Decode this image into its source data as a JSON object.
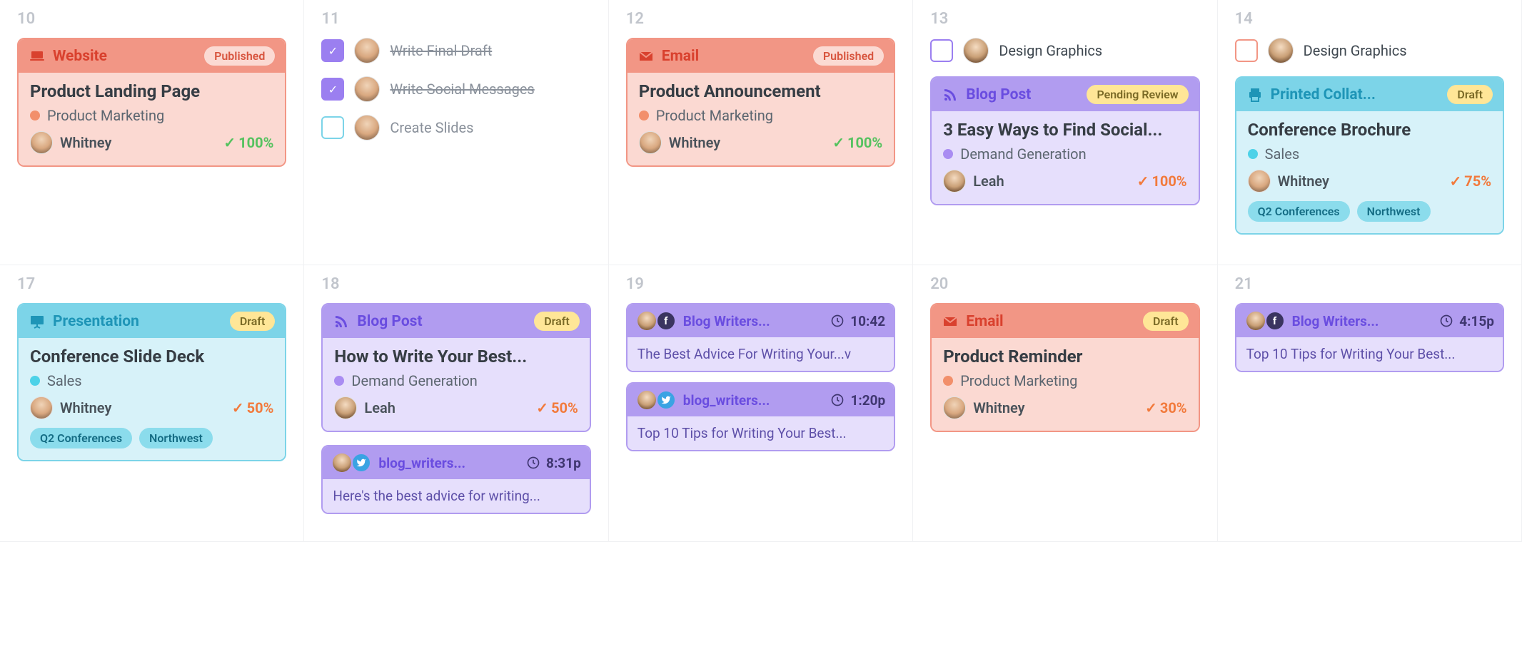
{
  "days": {
    "d10": "10",
    "d11": "11",
    "d12": "12",
    "d13": "13",
    "d14": "14",
    "d17": "17",
    "d18": "18",
    "d19": "19",
    "d20": "20",
    "d21": "21"
  },
  "categories": {
    "product_marketing": "Product Marketing",
    "demand_gen": "Demand Generation",
    "sales": "Sales"
  },
  "people": {
    "whitney": "Whitney",
    "leah": "Leah"
  },
  "types": {
    "website": "Website",
    "email": "Email",
    "blog": "Blog Post",
    "printed": "Printed Collat...",
    "presentation": "Presentation"
  },
  "statuses": {
    "published": "Published",
    "pending": "Pending Review",
    "draft": "Draft"
  },
  "tags": {
    "q2": "Q2 Conferences",
    "nw": "Northwest"
  },
  "tasks": {
    "d11": {
      "t1": "Write Final Draft",
      "t2": "Write Social Messages",
      "t3": "Create Slides"
    },
    "d13": {
      "t1": "Design Graphics"
    },
    "d14": {
      "t1": "Design Graphics"
    }
  },
  "cards": {
    "c1": {
      "title": "Product Landing Page",
      "progress": "100%"
    },
    "c2": {
      "title": "Product Announcement",
      "progress": "100%"
    },
    "c3": {
      "title": "3 Easy Ways to Find Social...",
      "progress": "100%"
    },
    "c4": {
      "title": "Conference Brochure",
      "progress": "75%"
    },
    "c5": {
      "title": "Conference Slide Deck",
      "progress": "50%"
    },
    "c6": {
      "title": "How to Write Your Best...",
      "progress": "50%"
    },
    "c7": {
      "title": "Product Reminder",
      "progress": "30%"
    }
  },
  "social": {
    "s1": {
      "handle": "Blog Writers...",
      "time": "10:42",
      "body": "The Best Advice For Writing Your...v"
    },
    "s2": {
      "handle": "blog_writers...",
      "time": "1:20p",
      "body": "Top 10 Tips for Writing Your Best..."
    },
    "s3": {
      "handle": "blog_writers...",
      "time": "8:31p",
      "body": "Here's the best advice for writing..."
    },
    "s4": {
      "handle": "Blog Writers...",
      "time": "4:15p",
      "body": "Top 10 Tips for Writing Your Best..."
    }
  }
}
